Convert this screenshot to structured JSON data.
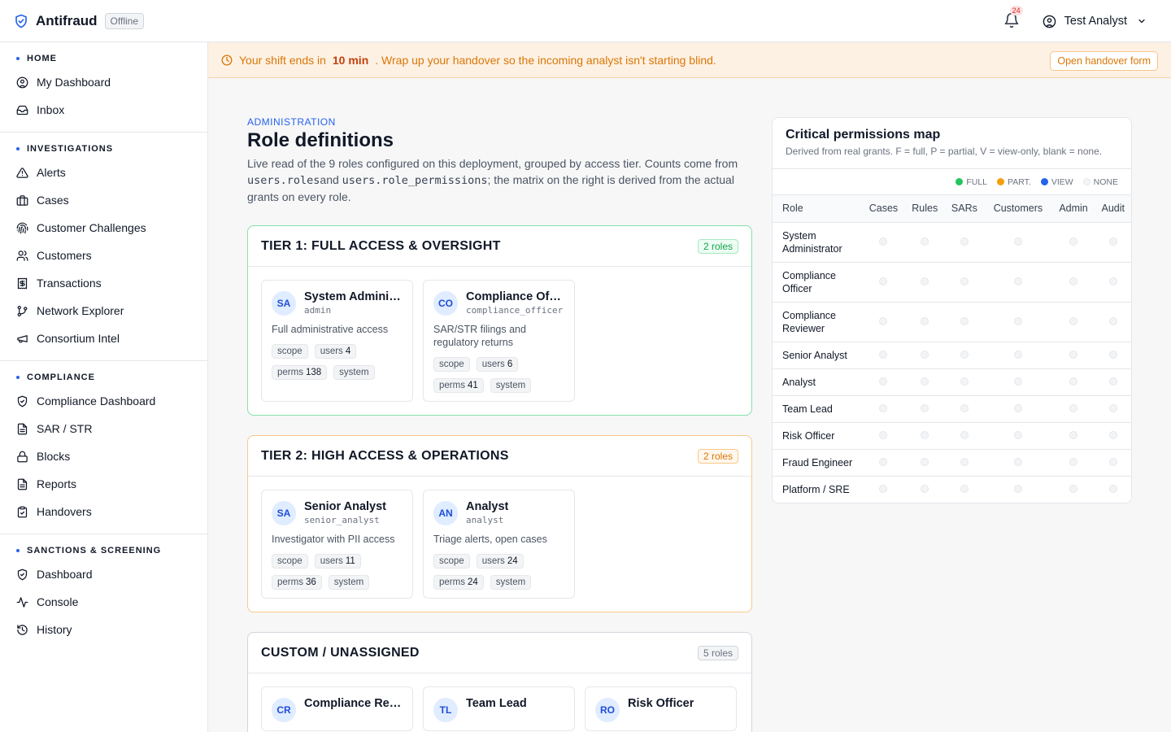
{
  "app": {
    "name": "Antifraud",
    "status_badge": "Offline"
  },
  "topbar": {
    "notification_count": "24",
    "user_name": "Test Analyst"
  },
  "sidebar": {
    "sections": [
      {
        "label": "HOME",
        "items": [
          "My Dashboard",
          "Inbox"
        ]
      },
      {
        "label": "INVESTIGATIONS",
        "items": [
          "Alerts",
          "Cases",
          "Customer Challenges",
          "Customers",
          "Transactions",
          "Network Explorer",
          "Consortium Intel"
        ]
      },
      {
        "label": "COMPLIANCE",
        "items": [
          "Compliance Dashboard",
          "SAR / STR",
          "Blocks",
          "Reports",
          "Handovers"
        ]
      },
      {
        "label": "SANCTIONS & SCREENING",
        "items": [
          "Dashboard",
          "Console",
          "History"
        ]
      }
    ]
  },
  "banner": {
    "prefix": "Your shift ends in",
    "time": "10 min",
    "suffix": ". Wrap up your handover so the incoming analyst isn't starting blind.",
    "button": "Open handover form"
  },
  "page": {
    "eyebrow": "ADMINISTRATION",
    "title": "Role definitions",
    "desc_1": "Live read of the 9 roles configured on this deployment, grouped by access tier. Counts come from ",
    "code_1": "users.roles",
    "desc_2": "and ",
    "code_2": "users.role_permissions",
    "desc_3": "; the matrix on the right is derived from the actual grants on every role."
  },
  "chip_labels": {
    "scope": "scope",
    "users": "users",
    "perms": "perms",
    "system": "system"
  },
  "tiers": [
    {
      "title": "TIER 1: FULL ACCESS & OVERSIGHT",
      "count": "2 roles",
      "roles": [
        {
          "initials": "SA",
          "name": "System Administrator",
          "key": "admin",
          "desc": "Full administrative access",
          "users": "4",
          "perms": "138"
        },
        {
          "initials": "CO",
          "name": "Compliance Officer",
          "key": "compliance_officer",
          "desc": "SAR/STR filings and regulatory returns",
          "users": "6",
          "perms": "41"
        }
      ]
    },
    {
      "title": "TIER 2: HIGH ACCESS & OPERATIONS",
      "count": "2 roles",
      "roles": [
        {
          "initials": "SA",
          "name": "Senior Analyst",
          "key": "senior_analyst",
          "desc": "Investigator with PII access",
          "users": "11",
          "perms": "36"
        },
        {
          "initials": "AN",
          "name": "Analyst",
          "key": "analyst",
          "desc": "Triage alerts, open cases",
          "users": "24",
          "perms": "24"
        }
      ]
    },
    {
      "title": "CUSTOM / UNASSIGNED",
      "count": "5 roles",
      "roles": [
        {
          "initials": "CR",
          "name": "Compliance Reviewer",
          "key": "",
          "desc": "",
          "users": "",
          "perms": ""
        },
        {
          "initials": "TL",
          "name": "Team Lead",
          "key": "",
          "desc": "",
          "users": "",
          "perms": ""
        },
        {
          "initials": "RO",
          "name": "Risk Officer",
          "key": "",
          "desc": "",
          "users": "",
          "perms": ""
        }
      ]
    }
  ],
  "permissions": {
    "title": "Critical permissions map",
    "subtitle": "Derived from real grants. F = full, P = partial, V = view-only, blank = none.",
    "legend": [
      {
        "label": "FULL",
        "color": "#22c55e"
      },
      {
        "label": "PART.",
        "color": "#f59e0b"
      },
      {
        "label": "VIEW",
        "color": "#2563eb"
      },
      {
        "label": "NONE",
        "color": "#f3f4f6"
      }
    ],
    "columns": [
      "Role",
      "Cases",
      "Rules",
      "SARs",
      "Customers",
      "Admin",
      "Audit"
    ],
    "rows": [
      "System Administrator",
      "Compliance Officer",
      "Compliance Reviewer",
      "Senior Analyst",
      "Analyst",
      "Team Lead",
      "Risk Officer",
      "Fraud Engineer",
      "Platform / SRE"
    ]
  }
}
